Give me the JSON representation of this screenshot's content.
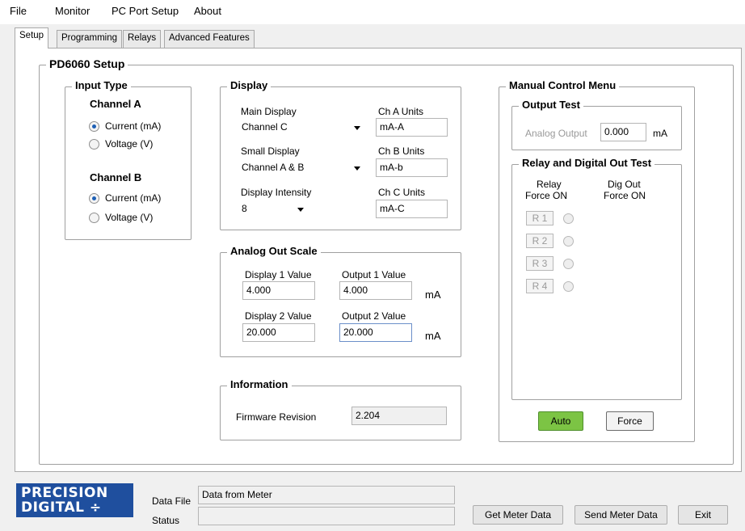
{
  "menu": [
    "File",
    "Monitor",
    "PC Port Setup",
    "About"
  ],
  "tabs": [
    "Setup",
    "Programming",
    "Relays",
    "Advanced Features"
  ],
  "setup_title": "PD6060 Setup",
  "input_type": {
    "title": "Input Type",
    "channel_a": "Channel A",
    "channel_b": "Channel B",
    "current": "Current (mA)",
    "voltage": "Voltage (V)"
  },
  "display": {
    "title": "Display",
    "main_display_label": "Main Display",
    "main_display_value": "Channel C",
    "small_display_label": "Small Display",
    "small_display_value": "Channel A & B",
    "intensity_label": "Display Intensity",
    "intensity_value": "8",
    "ch_a_units_label": "Ch A Units",
    "ch_a_units_value": "mA-A",
    "ch_b_units_label": "Ch B Units",
    "ch_b_units_value": "mA-b",
    "ch_c_units_label": "Ch C Units",
    "ch_c_units_value": "mA-C"
  },
  "analog_out_scale": {
    "title": "Analog Out Scale",
    "display1_label": "Display 1 Value",
    "display1_value": "4.000",
    "output1_label": "Output 1 Value",
    "output1_value": "4.000",
    "display2_label": "Display 2 Value",
    "display2_value": "20.000",
    "output2_label": "Output 2 Value",
    "output2_value": "20.000",
    "unit": "mA"
  },
  "information": {
    "title": "Information",
    "firmware_label": "Firmware Revision",
    "firmware_value": "2.204"
  },
  "manual_control": {
    "title": "Manual Control Menu",
    "output_test_title": "Output Test",
    "analog_output_label": "Analog Output",
    "analog_output_value": "0.000",
    "analog_output_unit": "mA",
    "relay_test_title": "Relay and Digital Out Test",
    "relay_header": "Relay",
    "relay_force_on": "Force  ON",
    "dig_out_header": "Dig Out",
    "dig_out_force_on": "Force   ON",
    "relays": [
      "R 1",
      "R 2",
      "R 3",
      "R 4"
    ],
    "auto_button": "Auto",
    "force_button": "Force"
  },
  "footer": {
    "logo_line1": "PRECISION",
    "logo_line2": "DIGITAL ÷",
    "data_file_label": "Data File",
    "data_file_value": "Data from Meter",
    "status_label": "Status",
    "status_value": "",
    "get_meter_data": "Get Meter Data",
    "send_meter_data": "Send Meter Data",
    "exit": "Exit"
  },
  "colors": {
    "auto_button": "#7cc444",
    "logo_background": "#1f4f9e"
  }
}
